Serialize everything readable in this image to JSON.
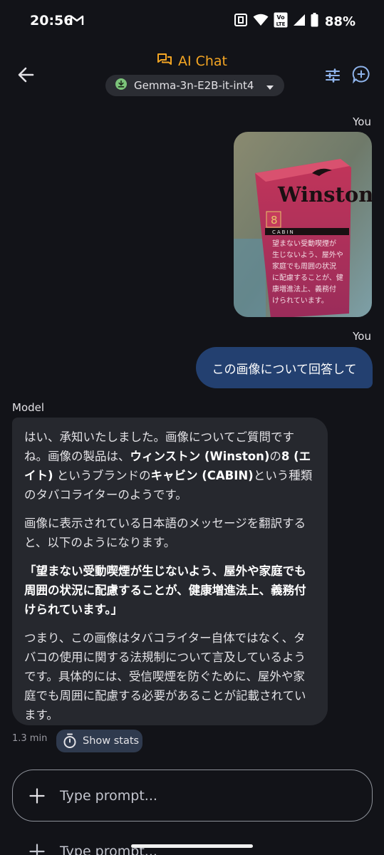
{
  "status_bar": {
    "time": "20:56",
    "battery": "88%",
    "volte": "Vo LTE"
  },
  "app_bar": {
    "title": "AI Chat",
    "model_name": "Gemma-3n-E2B-it-int4"
  },
  "messages": {
    "user_label_1": "You",
    "user_label_2": "You",
    "user_text": "この画像について回答して",
    "image_content": {
      "brand": "Winston",
      "number": "8",
      "variant": "CABIN",
      "warning_lines": [
        "望まない受動喫煙が",
        "生じないよう、屋外や",
        "家庭でも周囲の状況",
        "に配慮することが、健",
        "康増進法上、義務付",
        "けられています。"
      ]
    },
    "model_label": "Model",
    "model_p1_a": "はい、承知いたしました。画像についてご質問ですね。画像の製品は、",
    "model_p1_b1": "ウィンストン (Winston)",
    "model_p1_c": "の",
    "model_p1_b2": "8 (エイト)",
    "model_p1_d": " というブランドの",
    "model_p1_b3": "キャビン (CABIN)",
    "model_p1_e": "という種類のタバコライターのようです。",
    "model_p2": "画像に表示されている日本語のメッセージを翻訳すると、以下のようになります。",
    "model_p3": "「望まない受動喫煙が生じないよう、屋外や家庭でも周囲の状況に配慮することが、健康増進法上、義務付けられています。」",
    "model_p4": "つまり、この画像はタバコライター自体ではなく、タバコの使用に関する法規制について言及しているようです。具体的には、受信喫煙を防ぐために、屋外や家庭でも周囲に配慮する必要があることが記載されています。",
    "latency": "1.3 min",
    "stats_label": "Show stats"
  },
  "input": {
    "placeholder": "Type prompt...",
    "ghost_placeholder": "Type prompt..."
  },
  "colors": {
    "background": "#121318",
    "accent": "#f5a623",
    "user_bubble": "#234070",
    "model_bubble": "#26282e"
  }
}
